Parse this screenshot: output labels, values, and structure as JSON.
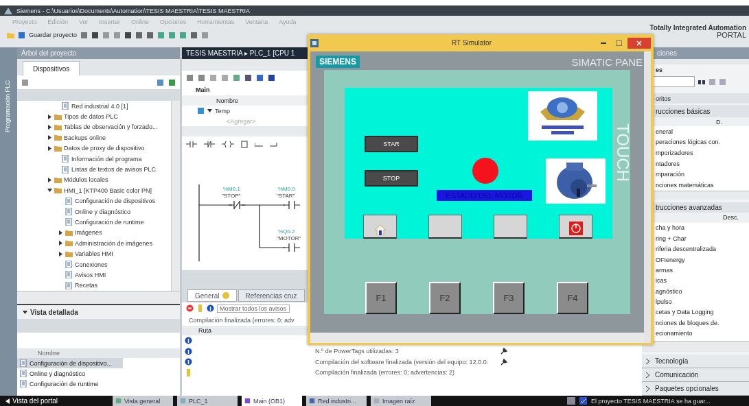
{
  "window": {
    "title": "Siemens  -  C:\\Usuarios\\Documents\\Automation\\TESIS MAESTRIA\\TESIS MAESTRIA"
  },
  "menu": [
    "Proyecto",
    "Edición",
    "Ver",
    "Insertar",
    "Online",
    "Opciones",
    "Herramientas",
    "Ventana",
    "Ayuda"
  ],
  "toolbar": {
    "save_label": "Guardar proyecto"
  },
  "brand": {
    "line1": "Totally Integrated Automation",
    "line2": "PORTAL"
  },
  "side_strip": {
    "label": "Programación PLC"
  },
  "project_tree": {
    "title": "Árbol del proyecto",
    "tab": "Dispositivos",
    "items": [
      {
        "label": "Red industrial 4.0 [1]"
      },
      {
        "label": "Tipos de datos PLC",
        "expanded": false
      },
      {
        "label": "Tablas de observación y forzado...",
        "expanded": false
      },
      {
        "label": "Backups online",
        "expanded": false
      },
      {
        "label": "Datos de proxy de dispositivo",
        "expanded": false
      },
      {
        "label": "Información del programa"
      },
      {
        "label": "Listas de textos de avisos PLC"
      },
      {
        "label": "Módulos locales",
        "expanded": false
      },
      {
        "label": "HMI_1 [KTP400 Basic color PN]",
        "expanded": true,
        "children": [
          {
            "label": "Configuración de dispositivos"
          },
          {
            "label": "Online y diagnóstico"
          },
          {
            "label": "Configuración de runtime"
          },
          {
            "label": "Imágenes",
            "expanded": false
          },
          {
            "label": "Administración de imágenes",
            "expanded": false
          },
          {
            "label": "Variables HMI",
            "expanded": false
          },
          {
            "label": "Conexiones"
          },
          {
            "label": "Avisos HMI"
          },
          {
            "label": "Recetas"
          }
        ]
      }
    ]
  },
  "detail_view": {
    "title": "Vista detallada",
    "column": "Nombre",
    "items": [
      {
        "label": "Configuración de dispositivo...",
        "selected": true
      },
      {
        "label": "Online y diagnóstico",
        "selected": false
      },
      {
        "label": "Configuración de runtime",
        "selected": false
      }
    ]
  },
  "editor": {
    "breadcrumb": "TESIS MAESTRIA ▸ PLC_1 [CPU 1",
    "block": "Main",
    "column": "Nombre",
    "rows": [
      {
        "name": "Temp",
        "expanded": true
      },
      {
        "name": "<Agregar>"
      }
    ],
    "contacts": [
      {
        "kind": "nc",
        "address": "%M0.1",
        "tag": "\"STOP\""
      },
      {
        "kind": "no",
        "address": "%M0.0",
        "tag": "\"STAR\""
      },
      {
        "kind": "no",
        "address": "%Q0.2",
        "tag": "\"MOTOR\""
      }
    ]
  },
  "inspector": {
    "tabs": [
      {
        "label": "General",
        "selected": true
      },
      {
        "label": "Referencias cruz",
        "selected": false
      }
    ],
    "filter": "Mostrar todos los avisos",
    "summary": "Compilación finalizada (errores: 0; adv",
    "column": "Ruta",
    "messages": [
      {
        "kind": "info"
      },
      {
        "kind": "info",
        "text": "N.º de PowerTags utilizadas: 3"
      },
      {
        "kind": "info",
        "text": "Compilación del software finalizada (versión del equipo: 12.0.0."
      },
      {
        "kind": "warning",
        "text": "Compilación finalizada (errores: 0; advertencias: 2)"
      }
    ]
  },
  "simulator": {
    "title": "RT Simulator",
    "brand": "SIEMENS",
    "model": "SIMATIC PANE",
    "touch": "TOUCH",
    "buttons": [
      "STAR",
      "STOP"
    ],
    "status_label": "ESTADO DEL MOTOR",
    "screen_buttons": [
      {
        "kind": "home"
      },
      {
        "kind": "blank"
      },
      {
        "kind": "blank"
      },
      {
        "kind": "power"
      }
    ],
    "function_keys": [
      "F1",
      "F2",
      "F3",
      "F4"
    ]
  },
  "instructions": {
    "title": "ciones",
    "options": "es",
    "favorites": "oritos",
    "basic": {
      "title": "rucciones básicas",
      "column": "D.",
      "items": [
        "eneral",
        "peraciones lógicas con.",
        "mporizadores",
        "ntadores",
        "mparación",
        "nciones matemáticas"
      ]
    },
    "advanced": {
      "title": "trucciones avanzadas",
      "column": "Desc.",
      "items": [
        "cha y hora",
        "ring + Char",
        "riferia descentralizada",
        "OFIenergy",
        "armas",
        "icas",
        "agnóstico",
        "lpulso",
        "cetas y Data Logging",
        "nciones de bloques de.",
        "ecionamiento"
      ]
    },
    "sections": [
      "Tecnología",
      "Comunicación",
      "Paquetes opcionales"
    ]
  },
  "taskbar": {
    "portal": "Vista del portal",
    "tabs": [
      {
        "label": "Vista general",
        "selected": false
      },
      {
        "label": "PLC_1",
        "selected": false
      },
      {
        "label": "Main (OB1)",
        "selected": true
      },
      {
        "label": "Red industri...",
        "selected": false
      },
      {
        "label": "Imagen raíz",
        "selected": false
      }
    ],
    "status": "El proyecto TESIS MAESTRIA se ha guar..."
  }
}
